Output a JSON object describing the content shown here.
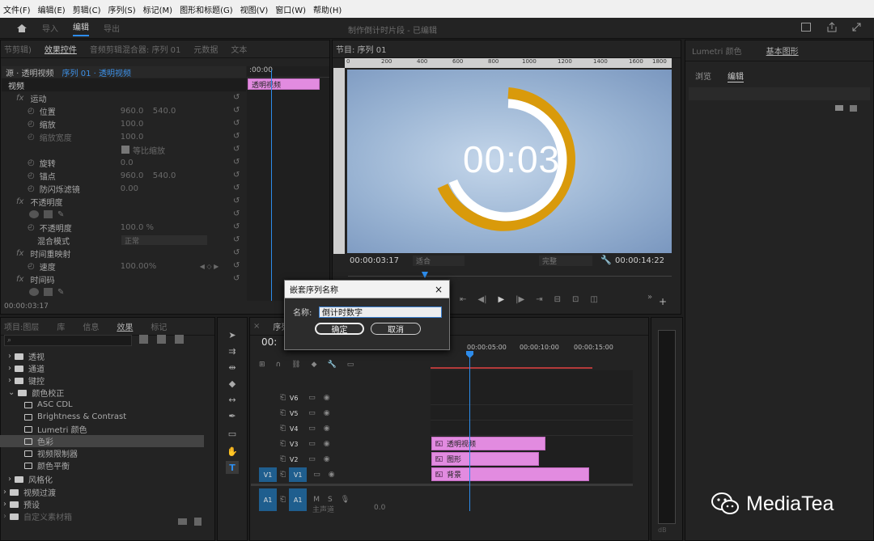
{
  "menu": [
    "文件(F)",
    "编辑(E)",
    "剪辑(C)",
    "序列(S)",
    "标记(M)",
    "图形和标题(G)",
    "视图(V)",
    "窗口(W)",
    "帮助(H)"
  ],
  "workspaces": [
    "导入",
    "编辑",
    "导出"
  ],
  "window_title": "制作倒计时片段 - 已编辑",
  "left_tabs": [
    "节剪辑)",
    "效果控件",
    "音频剪辑混合器: 序列 01",
    "元数据",
    "文本"
  ],
  "ec": {
    "source": "源 · 透明视频",
    "seq": "序列 01 · 透明视频",
    "section": "视频",
    "clip_label": "透明视频",
    "ruler_time": ":00:00",
    "timecode": "00:00:03:17",
    "props": [
      {
        "name": "运动",
        "v1": "",
        "v2": ""
      },
      {
        "name": "位置",
        "v1": "960.0",
        "v2": "540.0"
      },
      {
        "name": "缩放",
        "v1": "100.0",
        "v2": ""
      },
      {
        "name": "缩放宽度",
        "v1": "100.0",
        "v2": ""
      },
      {
        "name": "等比缩放",
        "v1": "",
        "v2": ""
      },
      {
        "name": "旋转",
        "v1": "0.0",
        "v2": ""
      },
      {
        "name": "锚点",
        "v1": "960.0",
        "v2": "540.0"
      },
      {
        "name": "防闪烁滤镜",
        "v1": "0.00",
        "v2": ""
      },
      {
        "name": "不透明度",
        "v1": "",
        "v2": ""
      },
      {
        "name": "不透明度",
        "v1": "100.0 %",
        "v2": ""
      },
      {
        "name": "混合模式",
        "v1": "正常",
        "v2": ""
      },
      {
        "name": "时间重映射",
        "v1": "",
        "v2": ""
      },
      {
        "name": "速度",
        "v1": "100.00%",
        "v2": ""
      },
      {
        "name": "时间码",
        "v1": "",
        "v2": ""
      }
    ]
  },
  "program": {
    "tab": "节目: 序列 01",
    "ruler": [
      "0",
      "200",
      "400",
      "600",
      "800",
      "1000",
      "1200",
      "1400",
      "1600",
      "1800"
    ],
    "countdown": "00:03",
    "timecode": "00:00:03:17",
    "duration": "00:00:14:22",
    "fit": "适合",
    "quality": "完整"
  },
  "right": {
    "tabs": [
      "Lumetri 颜色",
      "基本图形"
    ],
    "sub": [
      "浏览",
      "编辑"
    ]
  },
  "effects": {
    "tabs": [
      "项目:图层",
      "库",
      "信息",
      "效果",
      "标记"
    ],
    "items": [
      {
        "label": "透视",
        "type": "folder"
      },
      {
        "label": "通道",
        "type": "folder"
      },
      {
        "label": "键控",
        "type": "folder"
      },
      {
        "label": "颜色校正",
        "type": "folder"
      },
      {
        "label": "ASC CDL",
        "type": "fx"
      },
      {
        "label": "Brightness & Contrast",
        "type": "fx"
      },
      {
        "label": "Lumetri 颜色",
        "type": "fx"
      },
      {
        "label": "色彩",
        "type": "fx"
      },
      {
        "label": "视频限制器",
        "type": "fx"
      },
      {
        "label": "颜色平衡",
        "type": "fx"
      },
      {
        "label": "风格化",
        "type": "folder"
      },
      {
        "label": "视频过渡",
        "type": "folder"
      },
      {
        "label": "预设",
        "type": "folder"
      },
      {
        "label": "自定义素材箱",
        "type": "folder"
      }
    ]
  },
  "timeline": {
    "tab": "序列",
    "tc": "00:",
    "times": [
      "00:00:05:00",
      "00:00:10:00",
      "00:00:15:00"
    ],
    "tracks": [
      "V6",
      "V5",
      "V4",
      "V3",
      "V2",
      "V1",
      "A1"
    ],
    "clips": [
      {
        "label": "透明视频",
        "color": "#e28be0"
      },
      {
        "label": "图形",
        "color": "#e28be0"
      },
      {
        "label": "背景",
        "color": "#e28be0"
      }
    ],
    "audio_value": "0.0",
    "master": "主声道"
  },
  "meter": {
    "db": "dB"
  },
  "dialog": {
    "title": "嵌套序列名称",
    "name_label": "名称:",
    "name_value": "倒计时数字",
    "ok": "确定",
    "cancel": "取消"
  },
  "watermark": "MediaTea"
}
